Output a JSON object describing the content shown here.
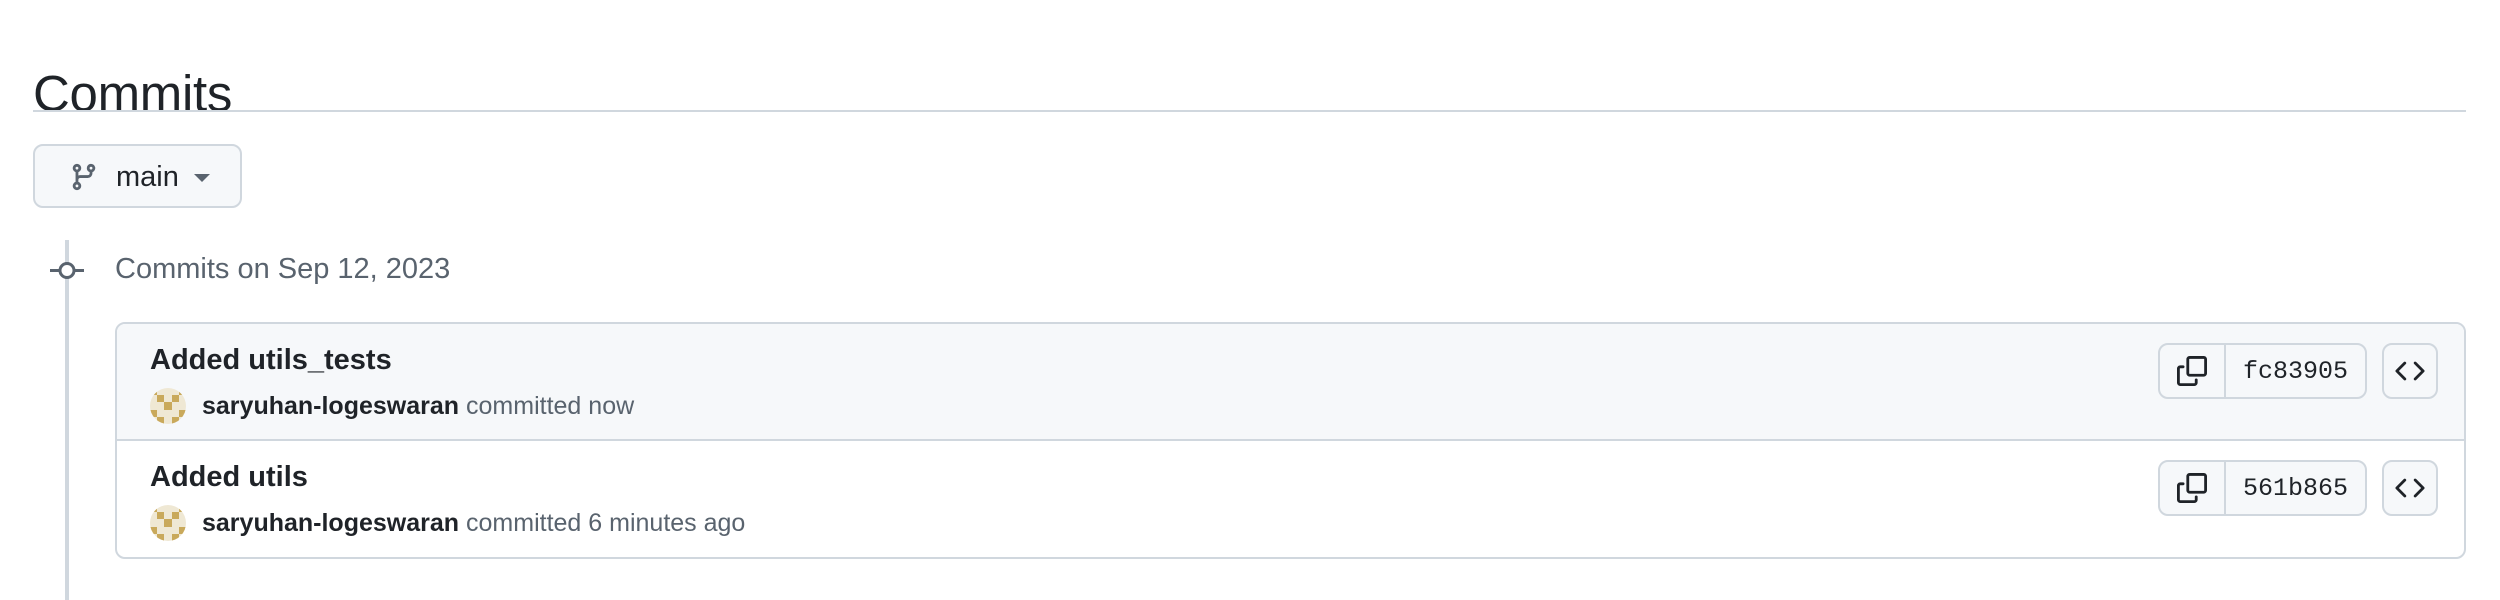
{
  "page": {
    "title": "Commits"
  },
  "branch": {
    "name": "main",
    "icon": "git-branch-icon"
  },
  "commit_group": {
    "header": "Commits on Sep 12, 2023"
  },
  "commits": [
    {
      "title": "Added utils_tests",
      "author": "saryuhan-logeswaran",
      "time_text": "committed now",
      "sha": "fc83905"
    },
    {
      "title": "Added utils",
      "author": "saryuhan-logeswaran",
      "time_text": "committed 6 minutes ago",
      "sha": "561b865"
    }
  ],
  "icons": {
    "copy": "copy-icon",
    "browse": "code-icon",
    "caret": "triangle-down-icon",
    "commit_node": "git-commit-icon"
  },
  "colors": {
    "text_primary": "#1f2328",
    "text_muted": "#59636e",
    "border": "#d0d7de",
    "button_bg": "#f6f8fa",
    "avatar_gold": "#c9a95b"
  }
}
